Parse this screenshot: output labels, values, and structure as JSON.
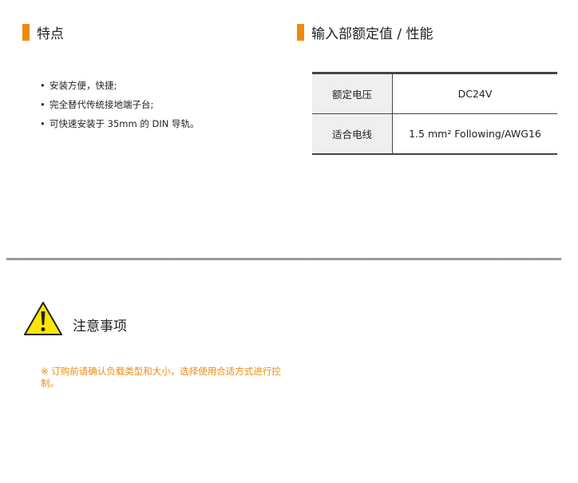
{
  "features": {
    "title": "特点",
    "items": [
      "安装方便，快捷;",
      "完全替代传统接地端子台;",
      "可快速安装于 35mm 的 DIN 导轨。"
    ]
  },
  "ratings": {
    "title": "输入部额定值 / 性能",
    "rows": [
      {
        "label": "额定电压",
        "value": "DC24V"
      },
      {
        "label": "适合电线",
        "value": "1.5 mm² Following/AWG16"
      }
    ]
  },
  "notice": {
    "title": "注意事项",
    "text": "※ 订购前请确认负载类型和大小，选择使用合适方式进行控制。"
  },
  "icons": {
    "warning": "warning-triangle-icon"
  },
  "colors": {
    "accent": "#f08a0d",
    "warning_fill": "#ffe600"
  }
}
